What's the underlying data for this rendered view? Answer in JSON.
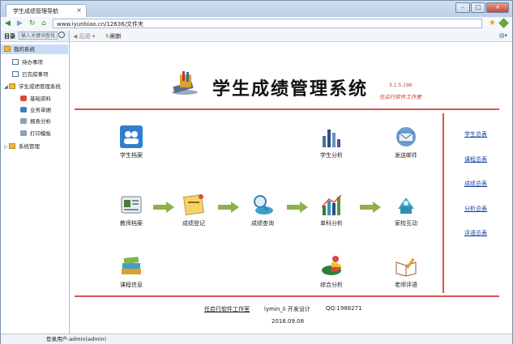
{
  "browser": {
    "tab_title": "学生成绩管理导航",
    "tab_close": "×",
    "url": "www.iyunbiao.cn/12636/文件夹",
    "win_min": "–",
    "win_max": "□",
    "win_close": "×"
  },
  "sidebar": {
    "title": "目录",
    "search_placeholder": "输入关键词查找",
    "items": [
      {
        "label": "我的系统"
      },
      {
        "label": "待办事项"
      },
      {
        "label": "已完成事项"
      },
      {
        "label": "学生成绩管理系统"
      },
      {
        "label": "基础资料"
      },
      {
        "label": "业务单据"
      },
      {
        "label": "报表分析"
      },
      {
        "label": "打印模板"
      },
      {
        "label": "系统管理"
      }
    ]
  },
  "toolbar": {
    "back_label": "后退",
    "refresh_label": "刷新"
  },
  "header": {
    "title": "学生成绩管理系统",
    "version": "3.1.5.196",
    "studio": "任启行软件工作室"
  },
  "modules": {
    "student_file": "学生档案",
    "student_analysis": "学生分析",
    "send_mail": "发送邮件",
    "teacher_file": "教师档案",
    "grade_entry": "成绩登记",
    "grade_query": "成绩查询",
    "subject_analysis": "单科分析",
    "home_school": "家校互动",
    "course_info": "课程信息",
    "overall_analysis": "综合分析",
    "teacher_review": "老师评语"
  },
  "right_links": [
    "学生总表",
    "课程总表",
    "成绩总表",
    "分析总表",
    "评语总表"
  ],
  "footer": {
    "studio": "任启行软件工作室",
    "designer": "lymin_li 开发设计",
    "qq": "QQ:1988271",
    "date": "2016.09.08"
  },
  "status": {
    "user": "登录用户:admin(admin)"
  }
}
